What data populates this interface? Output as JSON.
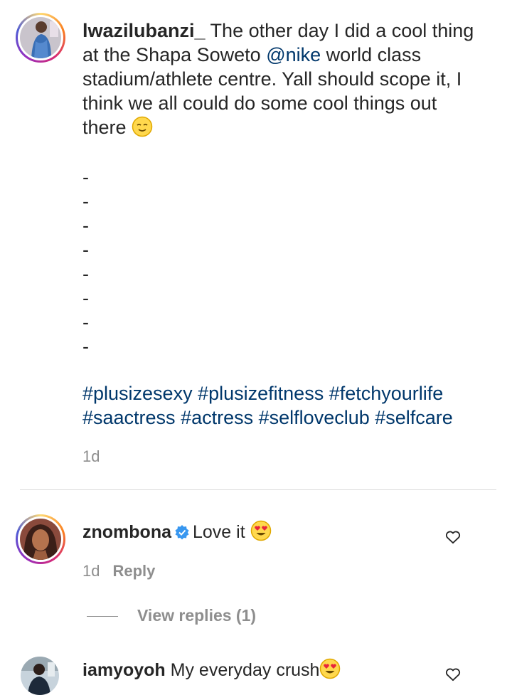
{
  "post": {
    "username": "lwazilubanzi_",
    "text_before_mention": " The other day I did a cool thing at the Shapa Soweto ",
    "mention": "@nike",
    "text_after_mention": " world class stadium/athlete centre. Yall should scope it, I think we all could do some cool things out there ",
    "emoji": "relieved-face",
    "dashes": [
      "-",
      "-",
      "-",
      "-",
      "-",
      "-",
      "-",
      "-"
    ],
    "hashtags": [
      "#plusizesexy",
      "#plusizefitness",
      "#fetchyourlife",
      "#saactress",
      "#actress",
      "#selfloveclub",
      "#selfcare"
    ],
    "time": "1d"
  },
  "comments": [
    {
      "username": "znombona",
      "verified": true,
      "text": "Love it",
      "emoji": "heart-eyes-face",
      "time": "1d",
      "reply_label": "Reply",
      "view_replies_label": "View replies (1)"
    },
    {
      "username": "iamyoyoh",
      "text": "My everyday crush",
      "emoji": "heart-eyes-face"
    }
  ],
  "colors": {
    "text": "#262626",
    "link": "#00376b",
    "secondary": "#8e8e8e",
    "verified": "#3897f0",
    "divider": "#dbdbdb"
  }
}
